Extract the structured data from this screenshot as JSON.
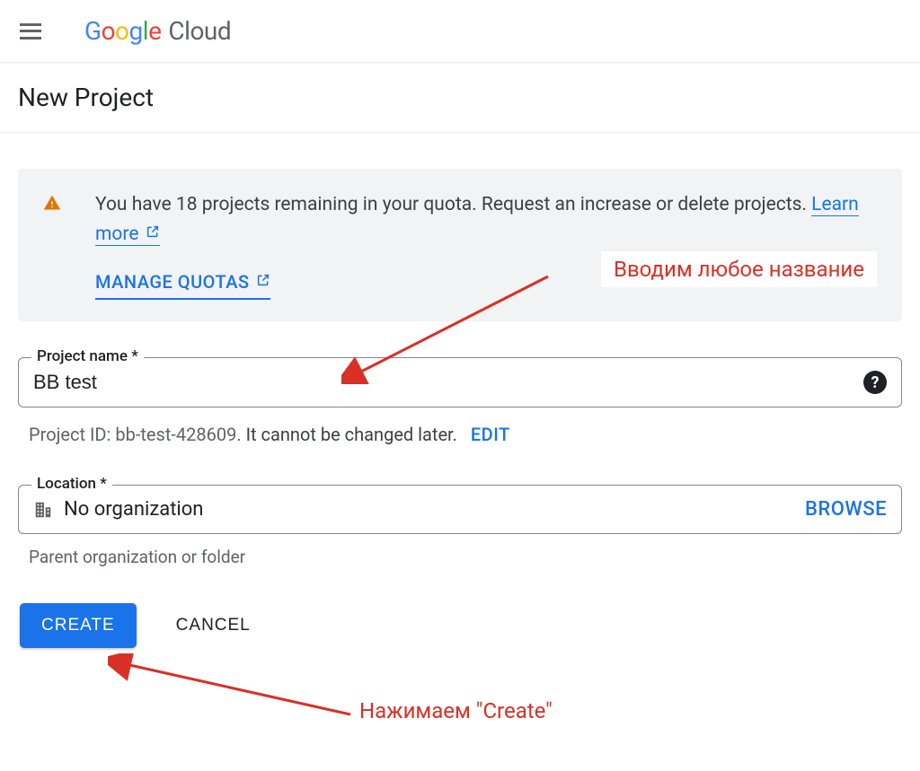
{
  "header": {
    "logo_google": "Google",
    "logo_cloud": "Cloud"
  },
  "page_title": "New Project",
  "quota": {
    "text_prefix": "You have 18 projects remaining in your quota. Request an increase or delete projects.",
    "learn_more": "Learn more",
    "manage_label": "MANAGE QUOTAS"
  },
  "project_name": {
    "label": "Project name *",
    "value": "BB test"
  },
  "project_id": {
    "prefix": "Project ID:",
    "value": "bb-test-428609.",
    "note": "It cannot be changed later.",
    "edit_label": "EDIT"
  },
  "location": {
    "label": "Location *",
    "value": "No organization",
    "browse_label": "BROWSE",
    "helper": "Parent organization or folder"
  },
  "buttons": {
    "create": "CREATE",
    "cancel": "CANCEL"
  },
  "annotations": {
    "a1": "Вводим любое название",
    "a2": "Нажимаем \"Create\""
  }
}
